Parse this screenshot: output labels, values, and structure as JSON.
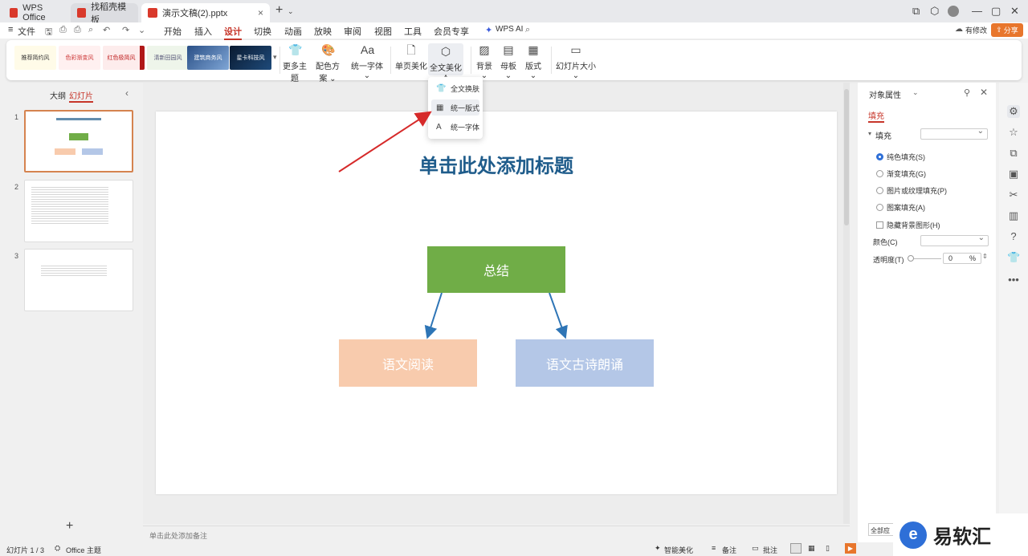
{
  "tabs": [
    {
      "label": "WPS Office",
      "color": "#d9392b"
    },
    {
      "label": "找稻壳模板",
      "color": "#d9392b"
    },
    {
      "label": "演示文稿(2).pptx",
      "color": "#d9392b"
    }
  ],
  "menu": {
    "file": "文件",
    "items": [
      "开始",
      "插入",
      "设计",
      "切换",
      "动画",
      "放映",
      "审阅",
      "视图",
      "工具",
      "会员专享"
    ],
    "active": "设计",
    "wps_ai": "WPS AI",
    "revise": "有修改",
    "share": "分享"
  },
  "ribbon": {
    "themes": [
      "推荐简约风",
      "色彩渐变风",
      "红色极简风",
      "清新田园风",
      "建筑商务风",
      "星卡科技风"
    ],
    "more_themes": "更多主题",
    "color_scheme": "配色方案",
    "unify_font": "统一字体",
    "single_beautify": "单页美化",
    "full_beautify": "全文美化",
    "background": "背景",
    "master": "母板",
    "layout": "版式",
    "slide_size": "幻灯片大小"
  },
  "dropdown": {
    "items": [
      "全文换肤",
      "统一版式",
      "统一字体"
    ]
  },
  "left_panel": {
    "outline": "大纲",
    "slides": "幻灯片",
    "thumb_numbers": [
      "1",
      "2",
      "3"
    ]
  },
  "slide": {
    "title": "单击此处添加标题",
    "top_box": "总结",
    "left_box": "语文阅读",
    "right_box": "语文古诗朗诵",
    "colors": {
      "title": "#1f5c8b",
      "top": "#70ad47",
      "left": "#f8cbad",
      "right": "#b4c7e7",
      "arrow": "#2e75b6"
    }
  },
  "notes": "单击此处添加备注",
  "properties": {
    "title": "对象属性",
    "fill_tab": "填充",
    "fill_label": "填充",
    "options": [
      "纯色填充(S)",
      "渐变填充(G)",
      "图片或纹理填充(P)",
      "图案填充(A)"
    ],
    "hide_bg": "隐藏背景图形(H)",
    "color_label": "颜色(C)",
    "transparency_label": "透明度(T)",
    "transparency_value": "0",
    "percent": "%",
    "apply_all": "全部应"
  },
  "status": {
    "slide_count": "幻灯片 1 / 3",
    "theme": "Office 主题",
    "smart_beautify": "智能美化",
    "notes": "备注",
    "comments": "批注"
  },
  "watermark": "易软汇"
}
